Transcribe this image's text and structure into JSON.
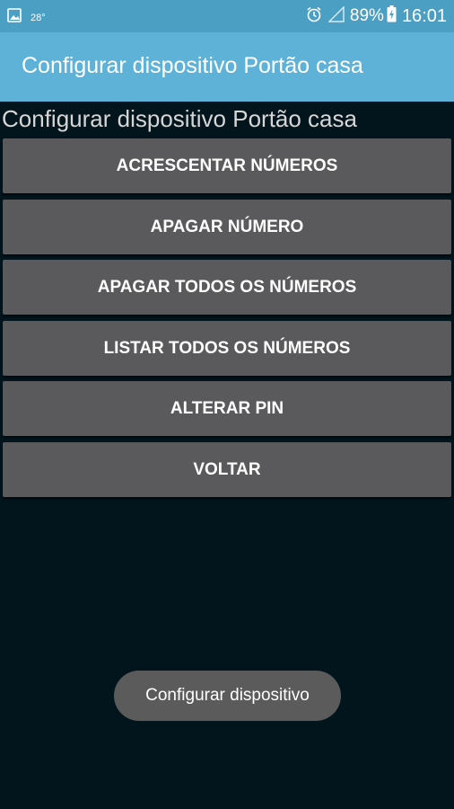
{
  "status_bar": {
    "temperature": "28°",
    "battery_percent": "89%",
    "time": "16:01",
    "icons": [
      "image-icon",
      "alarm-icon",
      "signal-icon",
      "battery-charging-icon"
    ]
  },
  "app_bar": {
    "title": "Configurar dispositivo Portão casa"
  },
  "content": {
    "title": "Configurar dispositivo Portão casa",
    "buttons": [
      "ACRESCENTAR NÚMEROS",
      "APAGAR NÚMERO",
      "APAGAR TODOS OS NÚMEROS",
      "LISTAR TODOS OS NÚMEROS",
      "ALTERAR PIN",
      "VOLTAR"
    ]
  },
  "toast": {
    "text": "Configurar dispositivo"
  },
  "colors": {
    "status_bar": "#4b9fc2",
    "app_bar": "#5eb2d7",
    "background": "#02141c",
    "button": "#5a5a5c",
    "toast": "#5b5b5b"
  }
}
